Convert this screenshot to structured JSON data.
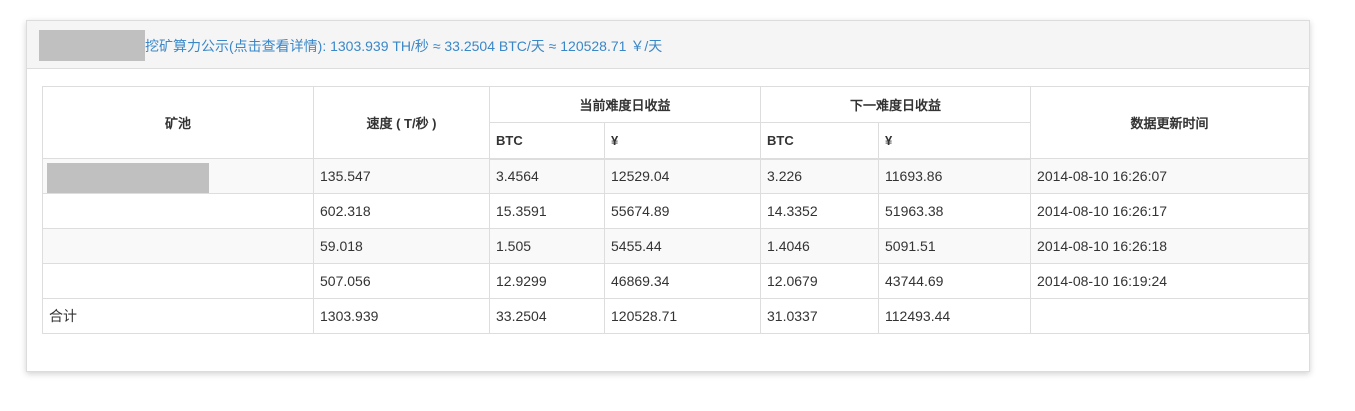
{
  "header": {
    "link_text": "挖矿算力公示(点击查看详情): 1303.939 TH/秒 ≈ 33.2504 BTC/天 ≈ 120528.71 ￥/天"
  },
  "table": {
    "headers": {
      "pool": "矿池",
      "speed": "速度 ( T/秒 )",
      "current_group": "当前难度日收益",
      "next_group": "下一难度日收益",
      "updated": "数据更新时间",
      "btc": "BTC",
      "cny": "¥"
    },
    "rows": [
      {
        "speed": "135.547",
        "cur_btc": "3.4564",
        "cur_cny": "12529.04",
        "next_btc": "3.226",
        "next_cny": "11693.86",
        "updated": "2014-08-10 16:26:07"
      },
      {
        "speed": "602.318",
        "cur_btc": "15.3591",
        "cur_cny": "55674.89",
        "next_btc": "14.3352",
        "next_cny": "51963.38",
        "updated": "2014-08-10 16:26:17"
      },
      {
        "speed": "59.018",
        "cur_btc": "1.505",
        "cur_cny": "5455.44",
        "next_btc": "1.4046",
        "next_cny": "5091.51",
        "updated": "2014-08-10 16:26:18"
      },
      {
        "speed": "507.056",
        "cur_btc": "12.9299",
        "cur_cny": "46869.34",
        "next_btc": "12.0679",
        "next_cny": "43744.69",
        "updated": "2014-08-10 16:19:24"
      }
    ],
    "total": {
      "label": "合计",
      "speed": "1303.939",
      "cur_btc": "33.2504",
      "cur_cny": "120528.71",
      "next_btc": "31.0337",
      "next_cny": "112493.44",
      "updated": ""
    }
  },
  "colors": {
    "link": "#3a87c8",
    "redaction": "#c0c0c0",
    "stripe": "#f9f9f9",
    "header_bg": "#f5f5f5"
  }
}
